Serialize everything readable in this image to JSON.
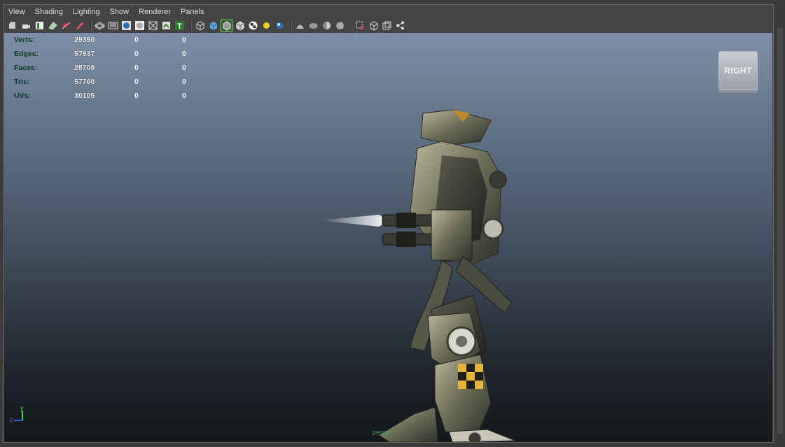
{
  "menu": [
    "View",
    "Shading",
    "Lighting",
    "Show",
    "Renderer",
    "Panels"
  ],
  "toolbar_icons": [
    "camera-attributes-icon",
    "camera-tools-icon",
    "bookmark-icon",
    "image-plane-icon",
    "grid-toggle-icon",
    "pencil-icon",
    "wireframe-icon",
    "shaded-icon",
    "smooth-shade-icon",
    "flat-shade-icon",
    "bounding-box-icon",
    "textured-icon",
    "text-icon",
    "cube-wire-icon",
    "cube-shaded-icon",
    "cube-select-icon",
    "cube-texture-icon",
    "checker-icon",
    "light-icon",
    "sphere-icon",
    "hud-icon",
    "shadow-icon",
    "ambient-occlusion-icon",
    "antialias-icon",
    "isolate-select-icon",
    "xray-icon",
    "xray-joints-icon",
    "node-graph-icon"
  ],
  "hud": {
    "rows": [
      {
        "label": "Verts:",
        "value": "29350",
        "sel": "0",
        "extra": "0"
      },
      {
        "label": "Edges:",
        "value": "57937",
        "sel": "0",
        "extra": "0"
      },
      {
        "label": "Faces:",
        "value": "28708",
        "sel": "0",
        "extra": "0"
      },
      {
        "label": "Tris:",
        "value": "57760",
        "sel": "0",
        "extra": "0"
      },
      {
        "label": "UVs:",
        "value": "30105",
        "sel": "0",
        "extra": "0"
      }
    ]
  },
  "viewcube": {
    "label": "RIGHT"
  },
  "axis": {
    "y": "y",
    "z": "z"
  },
  "camera_label": "persp",
  "colors": {
    "hud_label": "#0d3b2a",
    "hud_value": "#ffffff",
    "menu_text": "#dcdcdc"
  }
}
